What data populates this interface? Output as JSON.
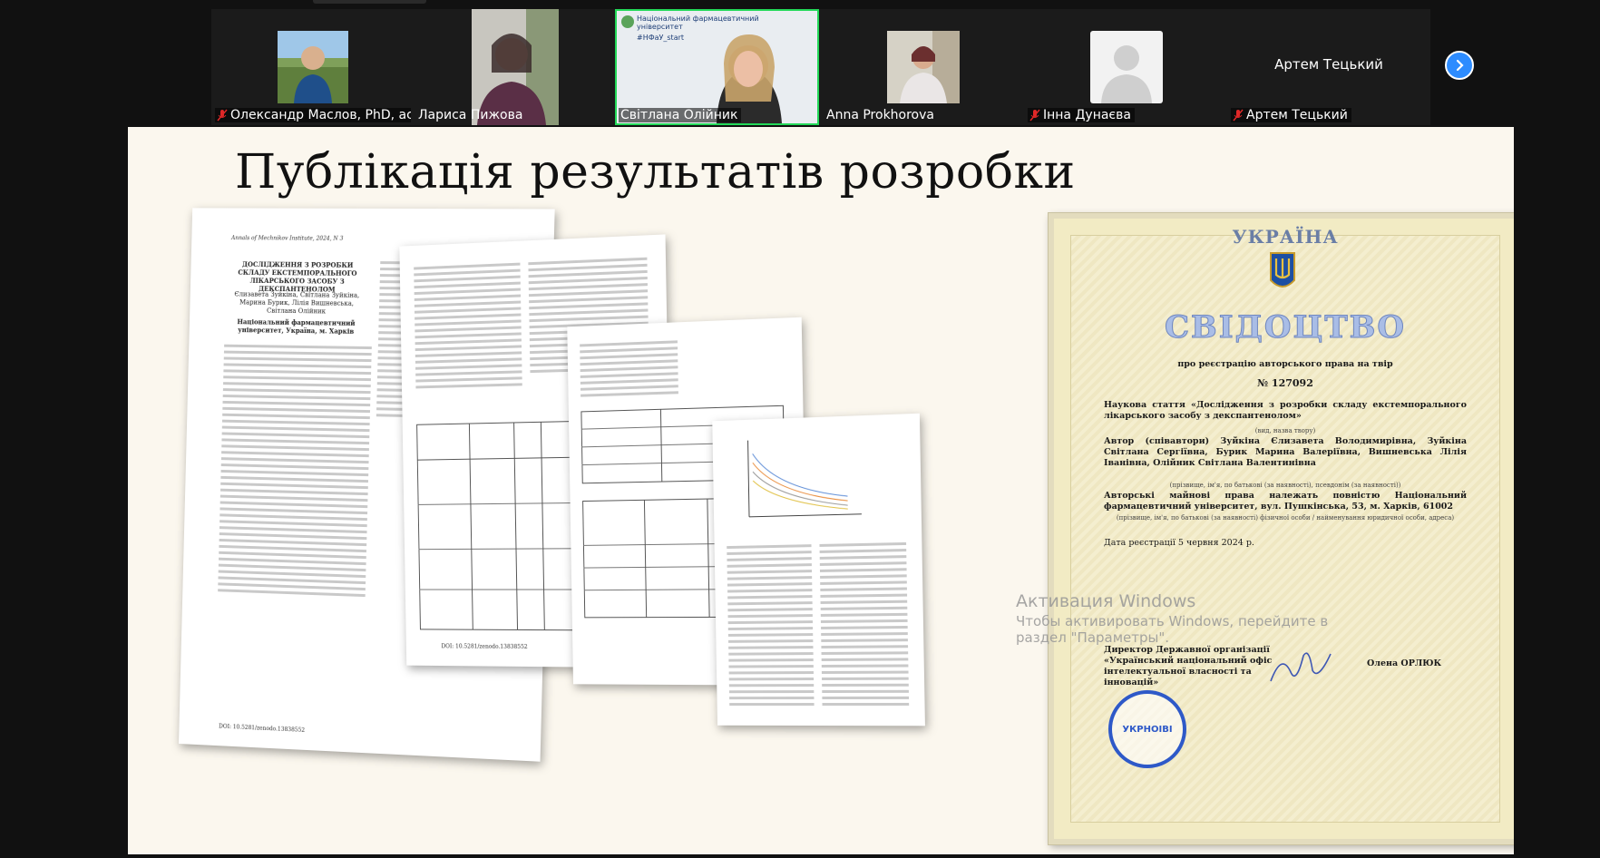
{
  "participants": [
    {
      "name": "Олександр Маслов, PhD, аси...",
      "muted": true
    },
    {
      "name": "Лариса Пижова",
      "muted": false
    },
    {
      "name": "Світлана Олійник",
      "muted": false,
      "active_speaker": true,
      "banner_line1": "Національний фармацевтичний",
      "banner_line2": "університет",
      "banner_tag": "#НФаУ_start"
    },
    {
      "name": "Anna Prokhorova",
      "muted": false
    },
    {
      "name": "Інна Дунаєва",
      "muted": true
    },
    {
      "name": "Артем Тецький",
      "muted": true,
      "center_label": "Артем Тецький"
    }
  ],
  "slide": {
    "title": "Публікація результатів розробки",
    "article": {
      "journal": "Annals of Mechnikov Institute, 2024, N 3",
      "heading": "ДОСЛІДЖЕННЯ З РОЗРОБКИ СКЛАДУ ЕКСТЕМПОРАЛЬНОГО ЛІКАРСЬКОГО ЗАСОБУ З ДЕКСПАНТЕНОЛОМ",
      "authors": "Єлизавета Зуйкіна, Світлана Зуйкіна, Марина Бурик, Лілія Вишневська, Світлана Олійник",
      "affiliation": "Національний фармацевтичний університет, Україна, м. Харків",
      "doi": "DOI: 10.5281/zenodo.13838552"
    },
    "page2_doi": "DOI: 10.5281/zenodo.13838552",
    "certificate": {
      "country": "УКРАЇНА",
      "title": "СВІДОЦТВО",
      "subtitle": "про реєстрацію авторського права на твір",
      "number": "№ 127092",
      "work": "Наукова стаття «Дослідження з розробки складу екстемпорального лікарського засобу з декспантенолом»",
      "work_caption": "(вид, назва твору)",
      "authors": "Автор (співавтори) Зуйкіна Єлизавета Володимирівна, Зуйкіна Світлана Сергіївна, Бурик Марина Валеріївна, Вишневська Лілія Іванівна, Олійник Світлана Валентинівна",
      "authors_caption": "(прізвище, ім'я, по батькові (за наявності), псевдонім (за наявності))",
      "rights": "Авторські майнові права належать повністю Національний фармацевтичний університет, вул. Пушкінська, 53, м. Харків, 61002",
      "rights_caption": "(прізвище, ім'я, по батькові (за наявності) фізичної особи / найменування юридичної особи, адреса)",
      "date": "Дата реєстрації 5 червня 2024 р.",
      "director": "Директор Державної організації «Український національний офіс інтелектуальної власності та інновацій»",
      "signer": "Олена ОРЛЮК",
      "stamp": "УКРНОІВІ"
    }
  },
  "windows_watermark": {
    "line1": "Активация Windows",
    "line2": "Чтобы активировать Windows, перейдите в",
    "line3": "раздел \"Параметры\"."
  },
  "colors": {
    "active_speaker_border": "#23d959",
    "next_button": "#2d8cff",
    "mic_off": "#e02828"
  },
  "icons": [
    "mic-off-icon",
    "chevron-right-icon",
    "avatar-placeholder-icon",
    "trident-emblem-icon"
  ]
}
